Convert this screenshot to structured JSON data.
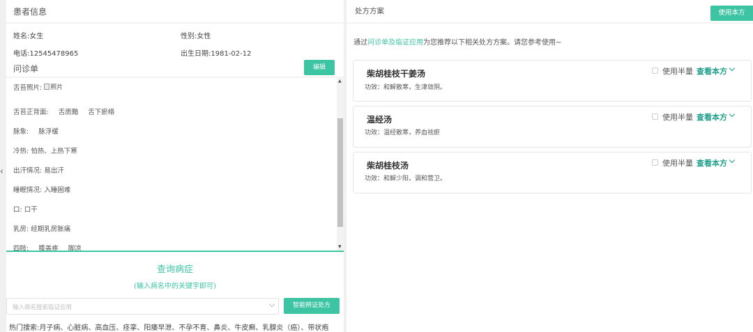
{
  "sidebar_toggle": "‹",
  "patient": {
    "title": "患者信息",
    "name": "姓名:女生",
    "gender": "性别:女性",
    "phone": "电话:12545478965",
    "birth": "出生日期:1981-02-12"
  },
  "inquiry": {
    "title": "问诊单",
    "edit_label": "编辑",
    "tongue_photo_label": "舌苔照片:",
    "tongue_photo_alt": "照片",
    "items": [
      {
        "label": "舌苔正背面:",
        "values": [
          "舌质黯",
          "舌下瘀络"
        ]
      },
      {
        "label": "脉象:",
        "values": [
          "脉浮缓"
        ]
      },
      {
        "label": "冷热: 怕热、上热下寒",
        "values": []
      },
      {
        "label": "出汗情况: 易出汗",
        "values": []
      },
      {
        "label": "睡眠情况: 入睡困难",
        "values": []
      },
      {
        "label": "口: 口干",
        "values": []
      },
      {
        "label": "乳房: 经期乳房胀痛",
        "values": []
      },
      {
        "label": "四肢:",
        "values": [
          "膝盖疼",
          "脚凉"
        ]
      }
    ]
  },
  "query": {
    "title": "查询病症",
    "subtitle": "(输入病名中的关键字即可)",
    "placeholder": "输入病名搜索临证应用",
    "smart_button": "智能辨证处方",
    "hot_label": "热门搜索:",
    "hot_items": [
      "月子病",
      "心脏病",
      "高血压",
      "痉挛",
      "阳痿早泄",
      "不孕不育",
      "鼻炎",
      "牛皮癣",
      "乳腺炎（癌）",
      "带状疱"
    ]
  },
  "prescription": {
    "title": "处方方案",
    "use_button": "使用本方",
    "intro_prefix": "通过",
    "intro_link": "问诊单及临证应用",
    "intro_suffix": "为您推荐以下相关处方方案。请您参考使用~",
    "half_label": "使用半量",
    "view_label": "查看本方",
    "cards": [
      {
        "name": "柴胡桂枝干姜汤",
        "effect": "功效：和解散寒，生津敛阴。"
      },
      {
        "name": "温经汤",
        "effect": "功效：温经散寒，养血祛瘀"
      },
      {
        "name": "柴胡桂枝汤",
        "effect": "功效：和解少阳，调和营卫。"
      }
    ]
  }
}
